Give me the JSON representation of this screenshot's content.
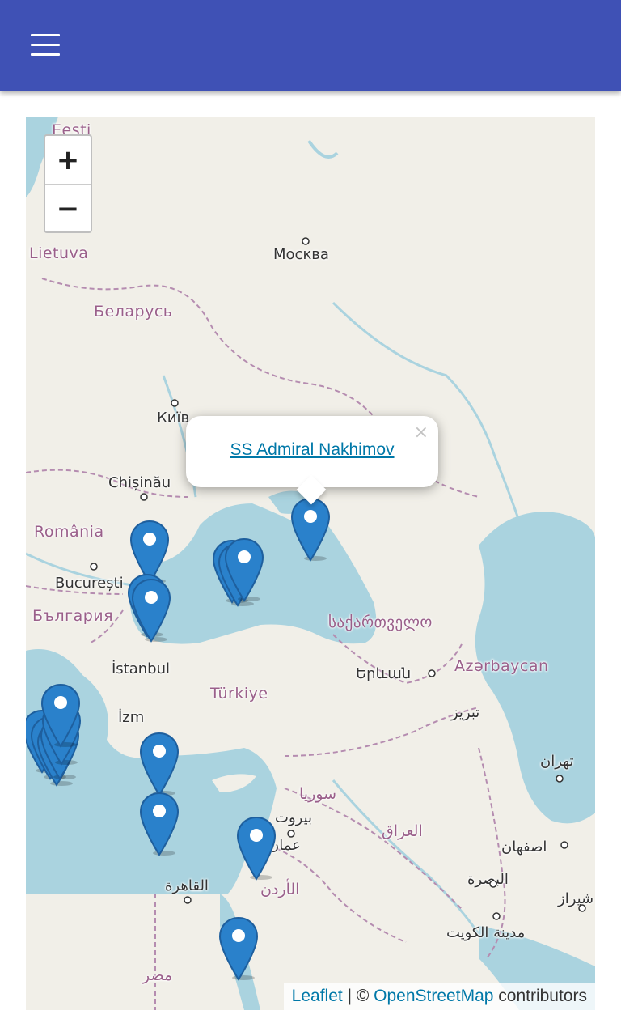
{
  "appbar": {
    "menu_icon": "hamburger-menu-icon",
    "color": "#3f51b5"
  },
  "map": {
    "zoom_in_label": "+",
    "zoom_out_label": "−",
    "water_color": "#aad3df",
    "land_color": "#f1efe8",
    "labels": {
      "eesti": "Eesti",
      "lietuva": "Lietuva",
      "moskva": "Москва",
      "belarus": "Беларусь",
      "kyiv": "Київ",
      "chisinau": "Chișinău",
      "romania": "România",
      "bucuresti": "București",
      "bulgaria": "България",
      "istanbul": "İstanbul",
      "turkiye": "Türkiye",
      "izmir": "İzm",
      "georgia": "საქართველო",
      "yerevan": "Երևան",
      "azerbaycan": "Azərbaycan",
      "tabriz": "تبریز",
      "tehran": "تهران",
      "syria": "سوريا",
      "beirut": "بيروت",
      "iraq": "العراق",
      "amman": "عمان",
      "isfahan": "اصفهان",
      "jordan": "الأردن",
      "cairo": "القاهرة",
      "basra": "البصرة",
      "shiraz": "شیراز",
      "kuwait": "مدينة الكويت",
      "egypt": "مصر"
    },
    "markers_icon": "map-marker-icon",
    "marker_color": "#2a81cb"
  },
  "popup": {
    "title": "SS Admiral Nakhimov",
    "close": "×"
  },
  "attribution": {
    "leaflet": "Leaflet",
    "separator": " | © ",
    "osm": "OpenStreetMap",
    "suffix": " contributors"
  }
}
